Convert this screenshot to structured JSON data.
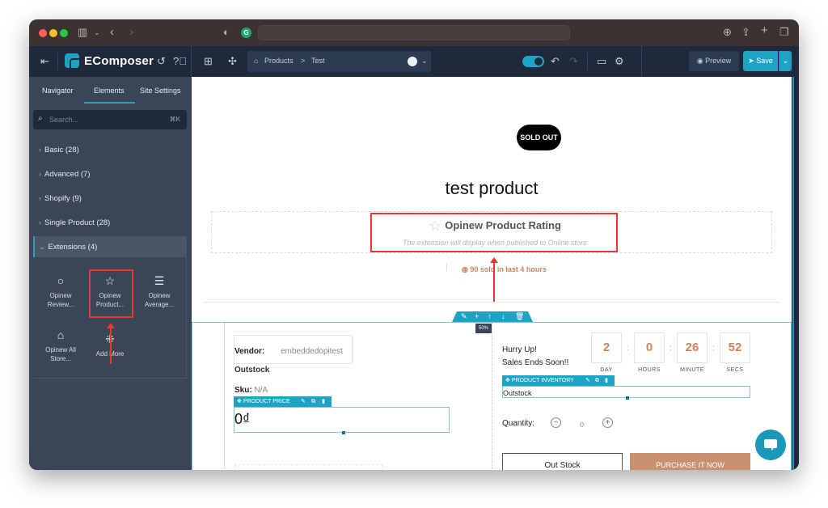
{
  "browser": {
    "url": "",
    "grammarly_label": "G"
  },
  "app": {
    "brand": "EComposer",
    "breadcrumb": {
      "parent": "Products",
      "separator": ">",
      "current": "Test"
    },
    "preview_label": "Preview",
    "save_label": "Save"
  },
  "sidebar": {
    "tabs": [
      {
        "label": "Navigator",
        "active": false
      },
      {
        "label": "Elements",
        "active": true
      },
      {
        "label": "Site Settings",
        "active": false
      }
    ],
    "search": {
      "placeholder": "Search...",
      "shortcut": "⌘K"
    },
    "categories": [
      {
        "label": "Basic (28)",
        "open": false
      },
      {
        "label": "Advanced (7)",
        "open": false
      },
      {
        "label": "Shopify (9)",
        "open": false
      },
      {
        "label": "Single Product (28)",
        "open": false
      },
      {
        "label": "Extensions (4)",
        "open": true
      }
    ],
    "extensions": [
      {
        "label": "Opinew Review...",
        "icon": "circle-icon"
      },
      {
        "label": "Opinew Product...",
        "icon": "star-icon",
        "highlighted": true
      },
      {
        "label": "Opinew Average...",
        "icon": "store-icon"
      },
      {
        "label": "Opinew All Store...",
        "icon": "storefront-icon"
      },
      {
        "label": "Add More",
        "icon": "grid-plus-icon"
      }
    ]
  },
  "canvas": {
    "badge": "SOLD OUT",
    "product_title": "test product",
    "rating": {
      "title": "Opinew Product Rating",
      "note": "The extension will display when published to Online store"
    },
    "sold_text": "90 sold in last 4 hours",
    "zoom_badge": "50%",
    "vendor_label": "Vendor:",
    "vendor_value": "embeddedopitest",
    "stock_status": "Outstock",
    "sku_label": "Sku:",
    "sku_value": "N/A",
    "price_tag": "PRODUCT PRICE",
    "price": "0₫",
    "timer": {
      "headline_1": "Hurry Up!",
      "headline_2": "Sales Ends Soon!!",
      "units": [
        {
          "value": "2",
          "label": "DAY"
        },
        {
          "value": "0",
          "label": "HOURS"
        },
        {
          "value": "26",
          "label": "MINUTE"
        },
        {
          "value": "52",
          "label": "SECS"
        }
      ]
    },
    "inventory_tag": "PRODUCT INVENTORY",
    "inventory_text": "Outstock",
    "quantity_label": "Quantity:",
    "quantity_value": "0",
    "btn_outstock": "Out Stock",
    "btn_purchase": "PURCHASE IT NOW"
  },
  "colors": {
    "accent": "#1fa3c5",
    "highlight": "#e23a2f",
    "countdown": "#c9845e",
    "purchase": "#c9906f"
  }
}
